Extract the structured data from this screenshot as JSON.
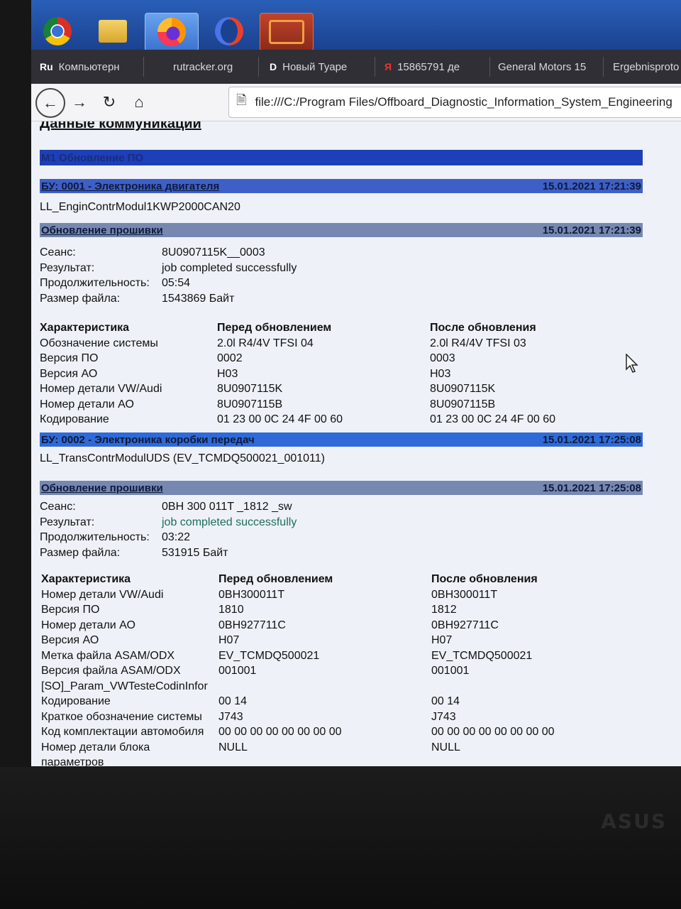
{
  "taskbar": {
    "apps": [
      "chrome-icon",
      "explorer-folder-icon",
      "firefox-icon",
      "opera-icon",
      "odis-engine-icon"
    ]
  },
  "tabs": [
    {
      "icon": "Ru",
      "label": "Компьютерн"
    },
    {
      "icon": "",
      "label": "rutracker.org"
    },
    {
      "icon": "D",
      "label": "Новый Туаре"
    },
    {
      "icon": "Я",
      "label": "15865791 де"
    },
    {
      "icon": "",
      "label": "General Motors 15"
    },
    {
      "icon": "",
      "label": "Ergebnisproto"
    }
  ],
  "nav": {
    "url": "file:///C:/Program Files/Offboard_Diagnostic_Information_System_Engineering"
  },
  "page": {
    "title": "Данные коммуникации",
    "section_bar": "M1 Обновление ПО",
    "blocks": [
      {
        "unit_bar": {
          "label": "БУ: 0001 - Электроника двигателя",
          "time": "15.01.2021 17:21:39"
        },
        "module": "LL_EnginContrModul1KWP2000CAN20",
        "update_bar": {
          "label": "Обновление прошивки",
          "time": "15.01.2021 17:21:39"
        },
        "kv": [
          {
            "k": "Сеанс:",
            "v": "8U0907115K__0003"
          },
          {
            "k": "Результат:",
            "v": "job completed successfully"
          },
          {
            "k": "Продолжительность:",
            "v": "05:54"
          },
          {
            "k": "Размер файла:",
            "v": "1543869 Байт"
          }
        ],
        "table_header": [
          "Характеристика",
          "Перед обновлением",
          "После обновления"
        ],
        "rows": [
          [
            "Обозначение системы",
            "2.0l R4/4V TFSI 04",
            "2.0l R4/4V TFSI 03"
          ],
          [
            "Версия ПО",
            "0002",
            "0003"
          ],
          [
            "Версия АО",
            "H03",
            "H03"
          ],
          [
            "Номер детали VW/Audi",
            "8U0907115K",
            "8U0907115K"
          ],
          [
            "Номер детали АО",
            "8U0907115B",
            "8U0907115B"
          ],
          [
            "Кодирование",
            "01 23 00 0C 24 4F 00 60",
            "01 23 00 0C 24 4F 00 60"
          ]
        ]
      },
      {
        "unit_bar": {
          "label": "БУ: 0002 - Электроника коробки передач",
          "time": "15.01.2021 17:25:08"
        },
        "module": "LL_TransContrModulUDS (EV_TCMDQ500021_001011)",
        "update_bar": {
          "label": "Обновление прошивки",
          "time": "15.01.2021 17:25:08"
        },
        "kv": [
          {
            "k": "Сеанс:",
            "v": "0BH 300 011T _1812 _sw"
          },
          {
            "k": "Результат:",
            "v": "job completed successfully"
          },
          {
            "k": "Продолжительность:",
            "v": "03:22"
          },
          {
            "k": "Размер файла:",
            "v": "531915 Байт"
          }
        ],
        "table_header": [
          "Характеристика",
          "Перед обновлением",
          "После обновления"
        ],
        "rows": [
          [
            "Номер детали VW/Audi",
            "0BH300011T",
            "0BH300011T"
          ],
          [
            "Версия ПО",
            "1810",
            "1812"
          ],
          [
            "Номер детали АО",
            "0BH927711C",
            "0BH927711C"
          ],
          [
            "Версия АО",
            "H07",
            "H07"
          ],
          [
            "Метка файла ASAM/ODX",
            "EV_TCMDQ500021",
            "EV_TCMDQ500021"
          ],
          [
            "Версия файла ASAM/ODX",
            "001001",
            "001001"
          ],
          [
            "[SO]_Param_VWTesteCodinInfor",
            "",
            ""
          ],
          [
            "Кодирование",
            "00 14",
            "00 14"
          ],
          [
            "Краткое обозначение системы",
            "J743",
            "J743"
          ],
          [
            "Код комплектации автомобиля",
            "00 00 00 00 00 00 00 00",
            "00 00 00 00 00 00 00 00"
          ],
          [
            "Номер детали блока",
            "NULL",
            "NULL"
          ],
          [
            "параметров",
            "",
            ""
          ]
        ]
      }
    ]
  },
  "bezel": {
    "brand": "ASUS"
  },
  "colors": {
    "taskbar": "#2a5fb8",
    "bar_dark": "#1d3fb8",
    "bar_grey": "#7788b0",
    "success": "#1c6e5a"
  }
}
